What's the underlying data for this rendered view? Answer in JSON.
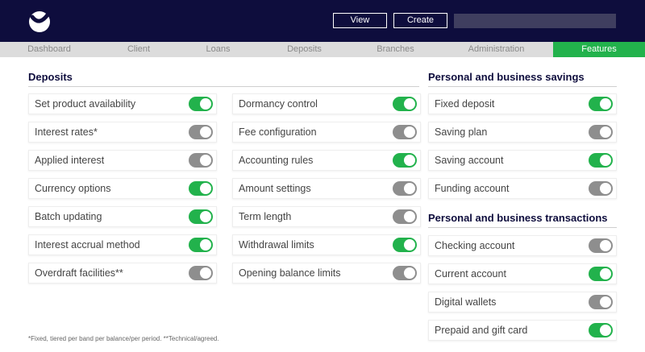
{
  "header": {
    "view_label": "View",
    "create_label": "Create",
    "search_value": ""
  },
  "nav": {
    "tabs": [
      {
        "label": "Dashboard",
        "active": false
      },
      {
        "label": "Client",
        "active": false
      },
      {
        "label": "Loans",
        "active": false
      },
      {
        "label": "Deposits",
        "active": false
      },
      {
        "label": "Branches",
        "active": false
      },
      {
        "label": "Administration",
        "active": false
      },
      {
        "label": "Features",
        "active": true
      }
    ]
  },
  "colors": {
    "header_bg": "#0e0d3d",
    "accent_green": "#22b24c",
    "toggle_off": "#8e8e8e"
  },
  "deposits": {
    "title": "Deposits",
    "col1": [
      {
        "label": "Set product availability",
        "on": true
      },
      {
        "label": "Interest rates*",
        "on": false
      },
      {
        "label": "Applied interest",
        "on": false
      },
      {
        "label": "Currency options",
        "on": true
      },
      {
        "label": "Batch updating",
        "on": true
      },
      {
        "label": "Interest accrual method",
        "on": true
      },
      {
        "label": "Overdraft facilities**",
        "on": false
      }
    ],
    "col2": [
      {
        "label": "Dormancy control",
        "on": true
      },
      {
        "label": "Fee configuration",
        "on": false
      },
      {
        "label": "Accounting rules",
        "on": true
      },
      {
        "label": "Amount settings",
        "on": false
      },
      {
        "label": "Term length",
        "on": false
      },
      {
        "label": "Withdrawal limits",
        "on": true
      },
      {
        "label": "Opening balance limits",
        "on": false
      }
    ]
  },
  "savings": {
    "title": "Personal and business savings",
    "items": [
      {
        "label": "Fixed deposit",
        "on": true
      },
      {
        "label": "Saving plan",
        "on": false
      },
      {
        "label": "Saving account",
        "on": true
      },
      {
        "label": "Funding account",
        "on": false
      }
    ]
  },
  "transactions": {
    "title": "Personal and business transactions",
    "items": [
      {
        "label": "Checking account",
        "on": false
      },
      {
        "label": "Current account",
        "on": true
      },
      {
        "label": "Digital wallets",
        "on": false
      },
      {
        "label": "Prepaid and gift card",
        "on": true
      }
    ]
  },
  "footnote": "*Fixed, tiered per band per balance/per period.   **Technical/agreed."
}
